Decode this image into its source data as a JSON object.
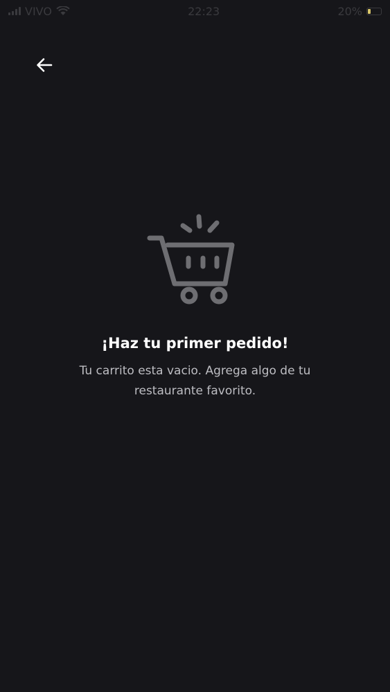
{
  "status_bar": {
    "carrier": "VIVO",
    "time": "22:23",
    "battery_percent": "20%",
    "battery_level": 0.2,
    "signal_icon": "signal-bars-icon",
    "wifi_icon": "wifi-icon",
    "battery_icon": "battery-icon"
  },
  "header": {
    "back_icon": "arrow-left-icon"
  },
  "empty_cart": {
    "icon": "shopping-cart-icon",
    "title": "¡Haz tu primer pedido!",
    "subtitle": "Tu carrito esta vacio. Agrega algo de tu restaurante favorito."
  },
  "colors": {
    "background": "#16161a",
    "icon_gray": "#6e6e72",
    "title": "#ffffff",
    "subtitle": "#bdbdc2",
    "battery_fill": "#d9c66a"
  }
}
